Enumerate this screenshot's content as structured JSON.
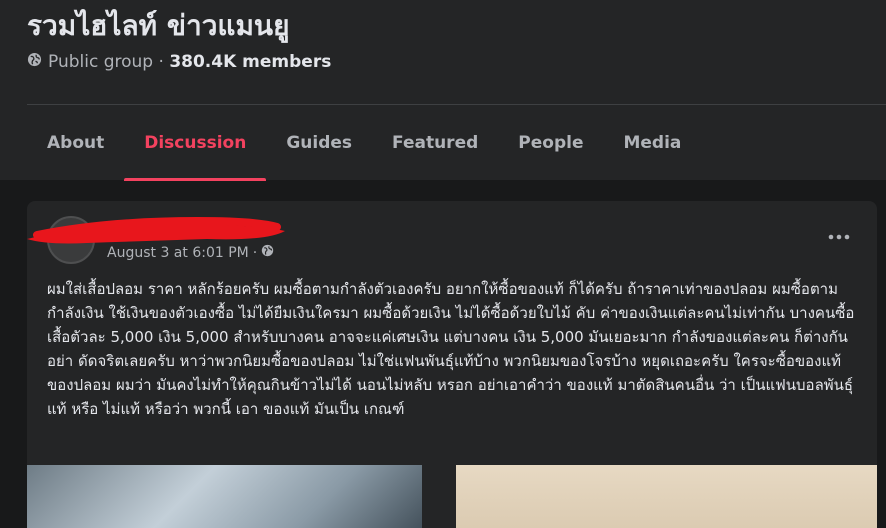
{
  "group": {
    "title": "รวมไฮไลท์ ข่าวแมนยู",
    "privacy": "Public group",
    "separator": " · ",
    "members": "380.4K members"
  },
  "tabs": [
    {
      "label": "About"
    },
    {
      "label": "Discussion",
      "active": true
    },
    {
      "label": "Guides"
    },
    {
      "label": "Featured"
    },
    {
      "label": "People"
    },
    {
      "label": "Media"
    }
  ],
  "post": {
    "timestamp": "August 3 at 6:01 PM",
    "dot": "·",
    "text": "ผมใส่เสื้อปลอม ราคา หลักร้อยครับ ผมซื้อตามกำลังตัวเองครับ อยากให้ซื้อของแท้ ก็ได้ครับ ถ้าราคาเท่าของปลอม ผมซื้อตามกำลังเงิน ใช้เงินของตัวเองซื้อ ไม่ได้ยืมเงินใครมา ผมซื้อด้วยเงิน ไม่ได้ซื้อด้วยใบไม้ คับ ค่าของเงินแต่ละคนไม่เท่ากัน บางคนซื้อเสื้อตัวละ 5,000 เงิน 5,000 สำหรับบางคน อาจจะแค่เศษเงิน แต่บางคน เงิน 5,000 มันเยอะมาก กำลังของแต่ละคน ก็ต่างกัน อย่า ดัดจริตเลยครับ หาว่าพวกนิยมซื้อของปลอม ไม่ใช่แฟนพันธุ์แท้บ้าง พวกนิยมของโจรบ้าง หยุดเถอะครับ ใครจะซื้อของแท้ของปลอม ผมว่า มันคงไม่ทำให้คุณกินข้าวไม่ได้ นอนไม่หลับ หรอก อย่าเอาคำว่า ของแท้ มาตัดสินคนอื่น ว่า เป็นแฟนบอลพันธุ์แท้ หรือ ไม่แท้ หรือว่า พวกนี้ เอา ของแท้ มันเป็น เกณฑ์"
  },
  "icons": {
    "globe": "globe-icon",
    "more": "more-options-icon"
  },
  "colors": {
    "accent": "#f3425f",
    "redaction": "#e8161c"
  }
}
